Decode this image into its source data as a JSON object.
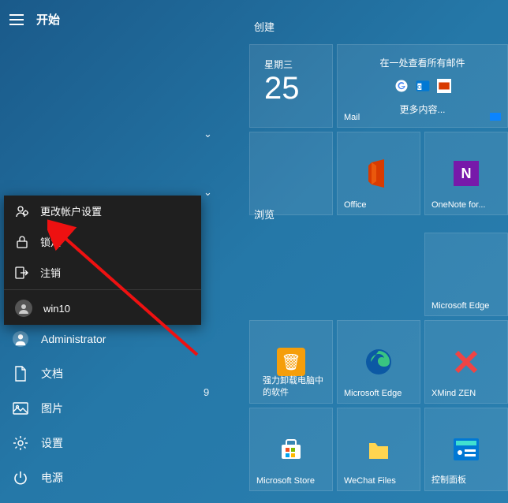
{
  "header": {
    "title": "开始"
  },
  "sections": {
    "create": "创建",
    "browse": "浏览"
  },
  "contextMenu": {
    "changeAccount": "更改帐户设置",
    "lock": "锁定",
    "signOut": "注销",
    "user": "win10"
  },
  "sidebar": {
    "admin": "Administrator",
    "documents": "文档",
    "pictures": "图片",
    "settings": "设置",
    "power": "电源"
  },
  "tiles": {
    "calendar": {
      "day": "星期三",
      "date": "25"
    },
    "mail": {
      "header": "在一处查看所有邮件",
      "more": "更多内容...",
      "label": "Mail"
    },
    "office": "Office",
    "onenote": "OneNote for...",
    "edge": "Microsoft Edge",
    "uninstall": "强力卸载电脑中的软件",
    "edge2": "Microsoft Edge",
    "xmind": "XMind ZEN",
    "store": "Microsoft Store",
    "wechat": "WeChat Files",
    "controlPanel": "控制面板"
  },
  "badge": "9"
}
